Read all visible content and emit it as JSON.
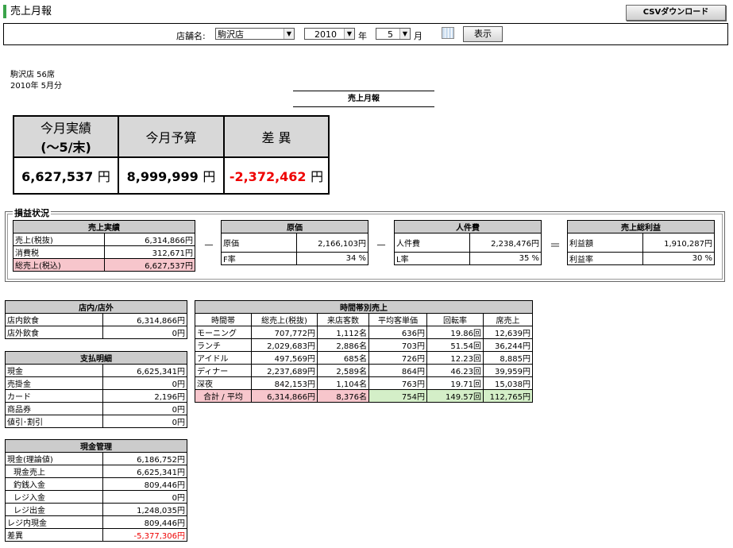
{
  "page": {
    "title": "売上月報",
    "csv_button": "CSVダウンロード"
  },
  "toolbar": {
    "store_label": "店舗名:",
    "store_value": "駒沢店",
    "year_value": "2010",
    "year_label": "年",
    "month_value": "5",
    "month_label": "月",
    "show_button": "表示"
  },
  "info": {
    "store_seats": "駒沢店  56席",
    "period": "2010年 5月分"
  },
  "report_title": "売上月報",
  "summary": {
    "h_actual": "今月実績",
    "h_actual2": "(～5/末)",
    "h_budget": "今月予算",
    "h_diff": "差 異",
    "v_actual": "6,627,537",
    "v_budget": "8,999,999",
    "v_diff": "-2,372,462",
    "unit": "円"
  },
  "pl": {
    "section_title": "損益状況",
    "sales": {
      "title": "売上実績",
      "rows": [
        [
          "売上(税抜)",
          "6,314,866円"
        ],
        [
          "消費税",
          "312,671円"
        ],
        [
          "総売上(税込)",
          "6,627,537円"
        ]
      ]
    },
    "cost": {
      "title": "原価",
      "rows": [
        [
          "原価",
          "2,166,103円"
        ],
        [
          "F率",
          "34 %"
        ]
      ]
    },
    "labor": {
      "title": "人件費",
      "rows": [
        [
          "人件費",
          "2,238,476円"
        ],
        [
          "L率",
          "35 %"
        ]
      ]
    },
    "gross": {
      "title": "売上総利益",
      "rows": [
        [
          "利益額",
          "1,910,287円"
        ],
        [
          "利益率",
          "30 %"
        ]
      ]
    },
    "op_minus": "－",
    "op_eq": "＝"
  },
  "inout": {
    "title": "店内/店外",
    "rows": [
      [
        "店内飲食",
        "6,314,866円"
      ],
      [
        "店外飲食",
        "0円"
      ]
    ]
  },
  "payment": {
    "title": "支払明細",
    "rows": [
      [
        "現金",
        "6,625,341円"
      ],
      [
        "売掛金",
        "0円"
      ],
      [
        "カード",
        "2,196円"
      ],
      [
        "商品券",
        "0円"
      ],
      [
        "値引･割引",
        "0円"
      ]
    ]
  },
  "cash": {
    "title": "現金管理",
    "rows": [
      [
        "現金(理論値)",
        "6,186,752円"
      ],
      [
        "現金売上",
        "6,625,341円"
      ],
      [
        "釣銭入金",
        "809,446円"
      ],
      [
        "レジ入金",
        "0円"
      ],
      [
        "レジ出金",
        "1,248,035円"
      ],
      [
        "レジ内現金",
        "809,446円"
      ],
      [
        "差異",
        "-5,377,306円"
      ]
    ]
  },
  "timeband": {
    "title": "時間帯別売上",
    "headers": [
      "時間帯",
      "総売上(税抜)",
      "来店客数",
      "平均客単価",
      "回転率",
      "席売上"
    ],
    "rows": [
      [
        "モーニング",
        "707,772円",
        "1,112名",
        "636円",
        "19.86回",
        "12,639円"
      ],
      [
        "ランチ",
        "2,029,683円",
        "2,886名",
        "703円",
        "51.54回",
        "36,244円"
      ],
      [
        "アイドル",
        "497,569円",
        "685名",
        "726円",
        "12.23回",
        "8,885円"
      ],
      [
        "ディナー",
        "2,237,689円",
        "2,589名",
        "864円",
        "46.23回",
        "39,959円"
      ],
      [
        "深夜",
        "842,153円",
        "1,104名",
        "763円",
        "19.71回",
        "15,038円"
      ]
    ],
    "total": [
      "合計 / 平均",
      "6,314,866円",
      "8,376名",
      "754円",
      "149.57回",
      "112,765円"
    ]
  }
}
